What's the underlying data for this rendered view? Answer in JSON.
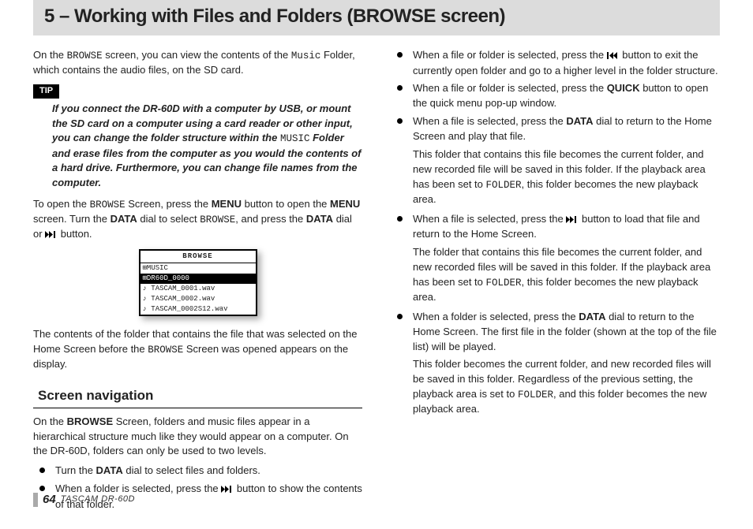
{
  "header": {
    "title": "5 – Working with Files and Folders (BROWSE screen)"
  },
  "left": {
    "intro_a": "On the ",
    "intro_b": " screen, you can view the contents of the ",
    "intro_c": " Folder, which contains the audio files, on the SD card.",
    "browse_mono": "BROWSE",
    "music_mono": "Music",
    "tip_label": "TIP",
    "tip_a": "If you connect the DR-60D with a computer by USB, or mount the SD card on a computer using a card reader or other input, you can change the folder structure within the ",
    "tip_music": "MUSIC",
    "tip_b": " Folder and erase files from the computer as you would the contents of a hard drive. Furthermore, you can change file names from the computer.",
    "open_a": "To open the ",
    "open_b": " Screen, press the ",
    "menu_bold": "MENU",
    "open_c": " button to open the ",
    "open_d": " screen. Turn the ",
    "data_bold": "DATA",
    "open_e": " dial to select ",
    "open_f": ", and press the ",
    "open_g": " dial or ",
    "open_h": " button.",
    "lcd": {
      "title": "BROWSE",
      "rows": [
        "⊞MUSIC",
        "⊞DR60D_0000",
        "♪ TASCAM_0001.wav",
        "♪ TASCAM_0002.wav",
        "♪ TASCAM_0002S12.wav"
      ],
      "selected_index": 1
    },
    "contents_a": "The contents of the folder that contains the file that was selected on the Home Screen before the ",
    "contents_b": " Screen was opened appears on the display.",
    "nav_head": "Screen navigation",
    "nav_p_a": "On the ",
    "nav_browse_bold": "BROWSE",
    "nav_p_b": " Screen, folders and music files appear in a hierarchical structure much like they would appear on a computer. On the DR-60D, folders can only be used to two levels.",
    "nav_li1_a": "Turn the ",
    "nav_li1_b": " dial to select files and folders.",
    "nav_li2_a": "When a folder is selected, press the ",
    "nav_li2_b": " button to show the contents of that folder."
  },
  "right": {
    "li1_a": "When a file or folder is selected, press the ",
    "li1_b": " button to exit the currently open folder and go to a higher level in the folder structure.",
    "li2_a": "When a file or folder is selected, press the ",
    "quick_bold": "QUICK",
    "li2_b": " button to open the quick menu pop-up window.",
    "li3_a": "When a file is selected, press the ",
    "li3_b": " dial to return to the Home Screen and play that file.",
    "li3_sub_a": "This folder that contains this file becomes the current folder, and new recorded file will be saved in this folder. If the playback area has been set to ",
    "folder_mono": "FOLDER",
    "li3_sub_b": ", this folder becomes the new playback area.",
    "li4_a": "When a file is selected, press the ",
    "li4_b": " button to load that file and return to the Home Screen.",
    "li4_sub_a": "The folder that contains this file becomes the current folder, and new recorded files will be saved in this folder. If the playback area has been set to ",
    "li4_sub_b": ", this folder becomes the new playback area.",
    "li5_a": "When a folder is selected, press the ",
    "li5_b": " dial to return to the Home Screen. The first file in the folder (shown at the top of the file list) will be played.",
    "li5_sub_a": "This folder becomes the current folder, and new recorded files will be saved in this folder. Regardless of the previous setting, the playback area is set to ",
    "li5_sub_b": ", and this folder becomes the new playback area."
  },
  "footer": {
    "page": "64",
    "model": "TASCAM  DR-60D"
  }
}
